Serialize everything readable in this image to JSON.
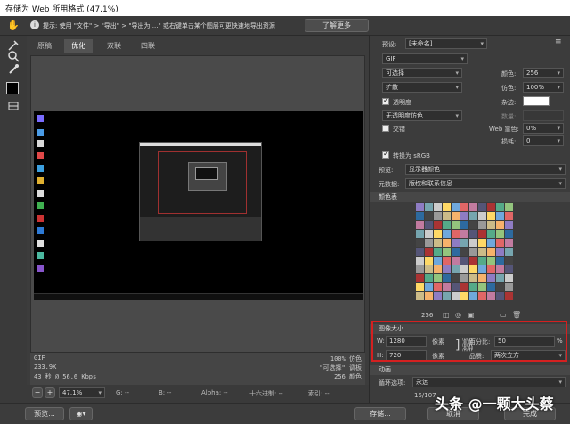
{
  "window": {
    "title": "存储为 Web 所用格式 (47.1%)"
  },
  "info": {
    "tip": "提示: 使用 \"文件\" > \"导出\" > \"导出为 ...\" 或右键单击某个图层可更快速地导出资源",
    "learn_more": "了解更多"
  },
  "tabs": [
    "原稿",
    "优化",
    "双联",
    "四联"
  ],
  "image_info": {
    "format": "GIF",
    "size": "233.9K",
    "speed": "43 秒 @ 56.6 Kbps",
    "dither": "100% 仿色",
    "palette": "\"可选择\" 调板",
    "colors": "256 颜色"
  },
  "status": {
    "zoom": "47.1%",
    "g": "G: --",
    "b": "B: --",
    "alpha": "Alpha: --",
    "hex": "十六进制: --",
    "index": "索引: --"
  },
  "bottom": {
    "preview": "预览...",
    "save": "存储...",
    "cancel": "取消",
    "done": "完成"
  },
  "right": {
    "preset_label": "预设:",
    "preset_value": "[未命名]",
    "format": "GIF",
    "reduction": "可选择",
    "colors_label": "颜色:",
    "colors_value": "256",
    "dither_algo": "扩散",
    "dither_label": "仿色:",
    "dither_value": "100%",
    "transparency": "透明度",
    "matte_label": "杂边:",
    "trans_dither": "无透明度仿色",
    "amount_label": "数量:",
    "interlaced": "交错",
    "websnap_label": "Web 靠色:",
    "websnap_value": "0%",
    "lossy_label": "损耗:",
    "lossy_value": "0",
    "srgb": "转换为 sRGB",
    "preview_label": "预览:",
    "preview_value": "显示器颜色",
    "metadata_label": "元数据:",
    "metadata_value": "版权和联系信息",
    "color_table": "颜色表",
    "color_count": "256",
    "image_size": "图像大小",
    "w_label": "W:",
    "w_value": "1280",
    "w_unit": "像素",
    "h_label": "H:",
    "h_value": "720",
    "h_unit": "像素",
    "percent_label": "百分比:",
    "percent_value": "50",
    "percent_unit": "%",
    "quality_label": "品质:",
    "quality_value": "两次立方",
    "animation": "动画",
    "loop_label": "循环选项:",
    "loop_value": "永远",
    "frame": "15/107"
  },
  "watermark": "头条 @一颗大头蔡"
}
